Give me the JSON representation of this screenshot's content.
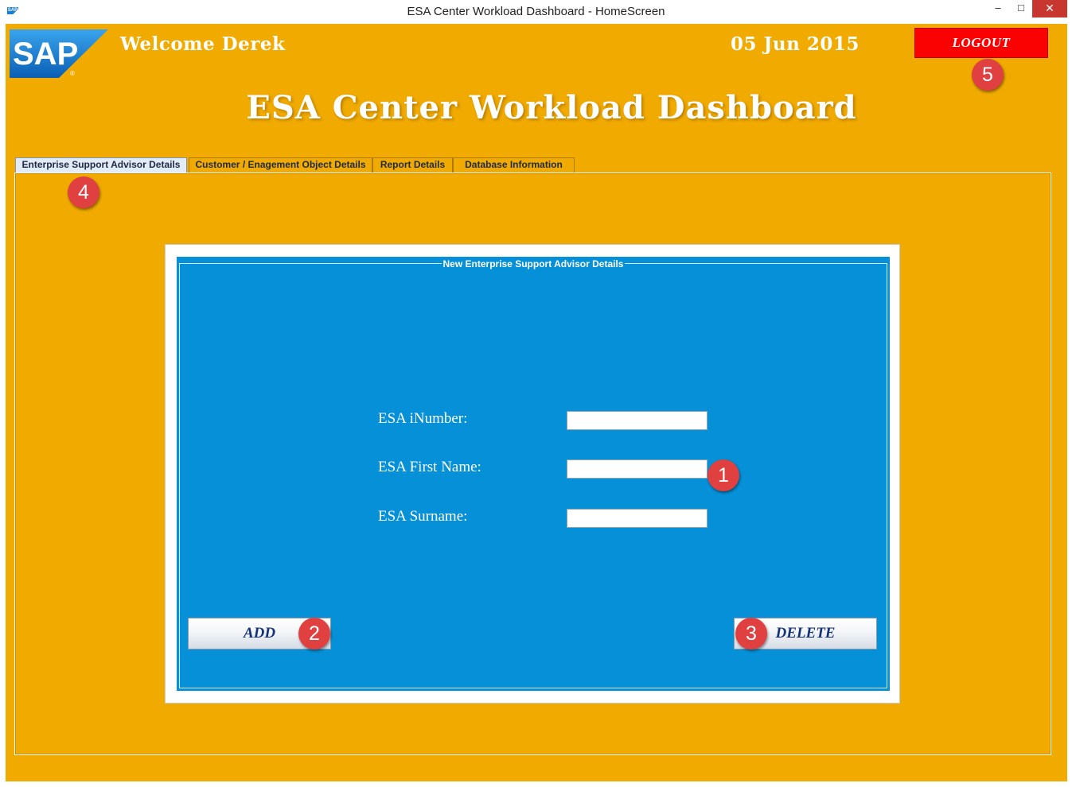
{
  "window": {
    "title": "ESA Center Workload Dashboard - HomeScreen",
    "minimize_glyph": "–",
    "maximize_glyph": "□",
    "close_glyph": "✕",
    "app_icon_text": "SAP"
  },
  "header": {
    "logo_text": "SAP",
    "welcome": "Welcome Derek",
    "date": "05 Jun 2015",
    "logout_label": "LOGOUT",
    "title": "ESA Center Workload Dashboard"
  },
  "tabs": [
    {
      "label": "Enterprise Support Advisor Details",
      "active": true
    },
    {
      "label": "Customer / Enagement Object Details",
      "active": false
    },
    {
      "label": "Report Details",
      "active": false
    },
    {
      "label": "Database Information",
      "active": false
    }
  ],
  "form": {
    "group_title": "New Enterprise Support Advisor Details",
    "fields": [
      {
        "label": "ESA iNumber:",
        "value": ""
      },
      {
        "label": "ESA First Name:",
        "value": ""
      },
      {
        "label": "ESA Surname:",
        "value": ""
      }
    ],
    "add_label": "ADD",
    "delete_label": "DELETE"
  },
  "callouts": [
    "1",
    "2",
    "3",
    "4",
    "5"
  ],
  "colors": {
    "background": "#f0aa00",
    "panel_blue": "#0690d8",
    "logout_red": "#fb0202",
    "callout_red": "#e04040",
    "button_text": "#14327a"
  }
}
